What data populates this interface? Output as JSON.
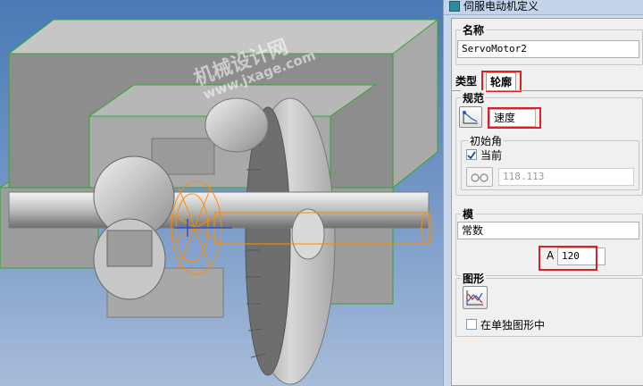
{
  "watermark": {
    "line1": "机械设计网",
    "line2": "www.jxage.com"
  },
  "dialog": {
    "title": "伺服电动机定义",
    "name_group_label": "名称",
    "name_value": "ServoMotor2",
    "tabs": [
      {
        "label": "类型"
      },
      {
        "label": "轮廓"
      }
    ],
    "spec_group_label": "规范",
    "spec_value": "速度",
    "initial_angle_label": "初始角",
    "current_label": "当前",
    "current_checked": true,
    "angle_value": "118.113",
    "model_group_label": "模",
    "model_value": "常数",
    "param_a_label": "A",
    "param_a_value": "120",
    "graph_group_label": "图形",
    "separate_graph_label": "在单独图形中",
    "separate_graph_checked": false
  },
  "colors": {
    "highlight_red": "#e02020",
    "selection_orange": "#ff8c00",
    "frame_green": "#2fa82f"
  },
  "icons": [
    "servo-motor-icon",
    "spec-graph-icon",
    "glasses-icon",
    "graph-icon"
  ]
}
